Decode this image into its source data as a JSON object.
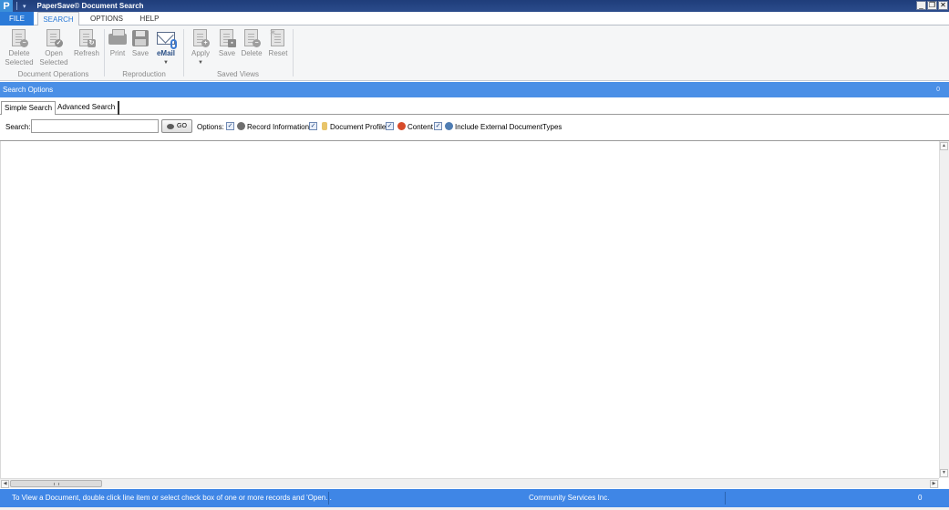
{
  "window": {
    "logo_letter": "P",
    "quick_access_icon": "down-arrow",
    "title": "PaperSave© Document Search",
    "controls": [
      "_",
      "❐",
      "✕"
    ]
  },
  "ribbon_tabs": [
    "FILE",
    "SEARCH",
    "OPTIONS",
    "HELP"
  ],
  "ribbon": {
    "groups": {
      "document_operations": "Document Operations",
      "reproduction": "Reproduction",
      "saved_views": "Saved Views"
    },
    "buttons": {
      "delete_selected": [
        "Delete",
        "Selected"
      ],
      "open_selected": [
        "Open",
        "Selected"
      ],
      "refresh": "Refresh",
      "print": "Print",
      "save": "Save",
      "email": "eMail",
      "apply": "Apply",
      "save_view": "Save",
      "delete_view": "Delete",
      "reset": "Reset"
    }
  },
  "search_options": {
    "header": "Search Options",
    "pin_glyph": "0",
    "tabs": {
      "simple": "Simple Search",
      "advanced": "Advanced Search"
    },
    "search_label": "Search:",
    "search_value": "",
    "go_label": "GO",
    "options_label": "Options:",
    "options": [
      {
        "label": "Record Information",
        "checked": true,
        "icon": "user-icon"
      },
      {
        "label": "Document Profile",
        "checked": true,
        "icon": "profile-icon"
      },
      {
        "label": "Content",
        "checked": true,
        "icon": "content-icon"
      },
      {
        "label": "Include External DocumentTypes",
        "checked": true,
        "icon": "globe-icon"
      }
    ]
  },
  "status": {
    "message": "To View a Document, double click line item or select check box of one or more records and 'Open...",
    "organization": "Community Services Inc.",
    "count": "0"
  },
  "colors": {
    "accent": "#4a8fe6",
    "status_bar": "#3f86e6",
    "title_bar": "#1f3d7a"
  }
}
